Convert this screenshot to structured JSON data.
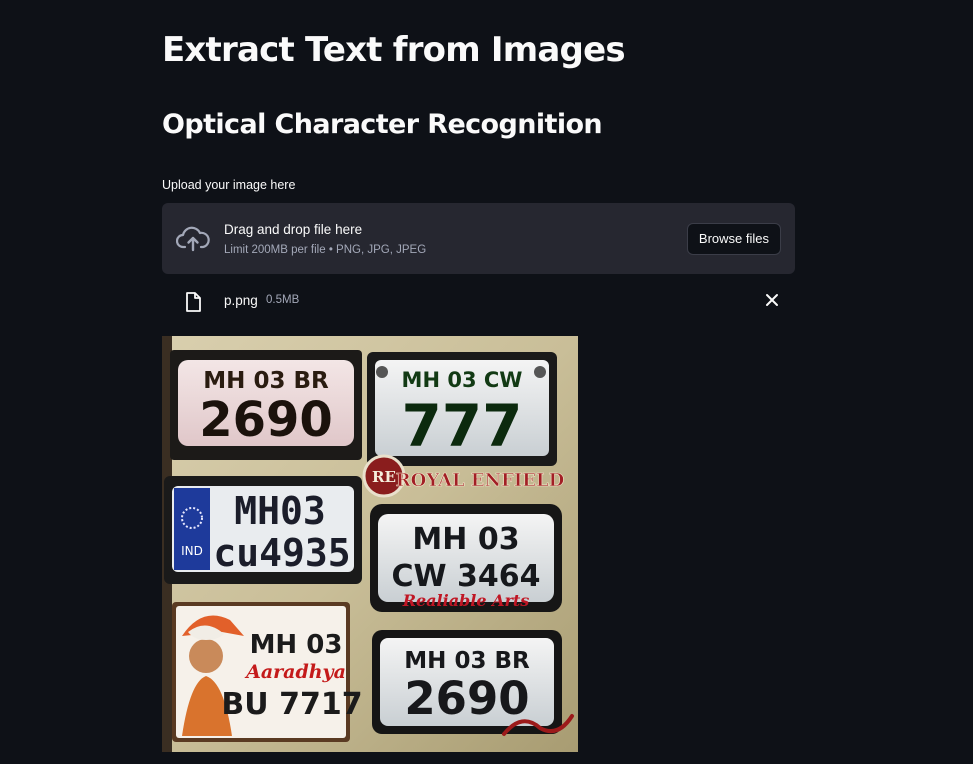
{
  "page": {
    "title": "Extract Text from Images",
    "subtitle": "Optical Character Recognition"
  },
  "uploader": {
    "label": "Upload your image here",
    "drop_title": "Drag and drop file here",
    "limit_text": "Limit 200MB per file • PNG, JPG, JPEG",
    "browse_label": "Browse files",
    "icon": "cloud-upload-icon"
  },
  "uploaded_file": {
    "name": "p.png",
    "size": "0.5MB",
    "icon": "file-icon",
    "remove_icon": "close-icon"
  },
  "image": {
    "plates": [
      {
        "line1": "MH 03 BR",
        "line2": "2690"
      },
      {
        "line1": "MH 03 CW",
        "line2": "777"
      },
      {
        "line1": "MH03",
        "line2": "cu4935",
        "tag": "IND"
      },
      {
        "line1": "MH 03",
        "line2": "CW 3464",
        "footer": "Realiable Arts"
      },
      {
        "line1": "MH 03",
        "line2": "BU 7717",
        "middle": "Aaradhya"
      },
      {
        "line1": "MH 03 BR",
        "line2": "2690"
      }
    ],
    "brand": "ROYAL ENFIELD",
    "badge": "RE"
  }
}
